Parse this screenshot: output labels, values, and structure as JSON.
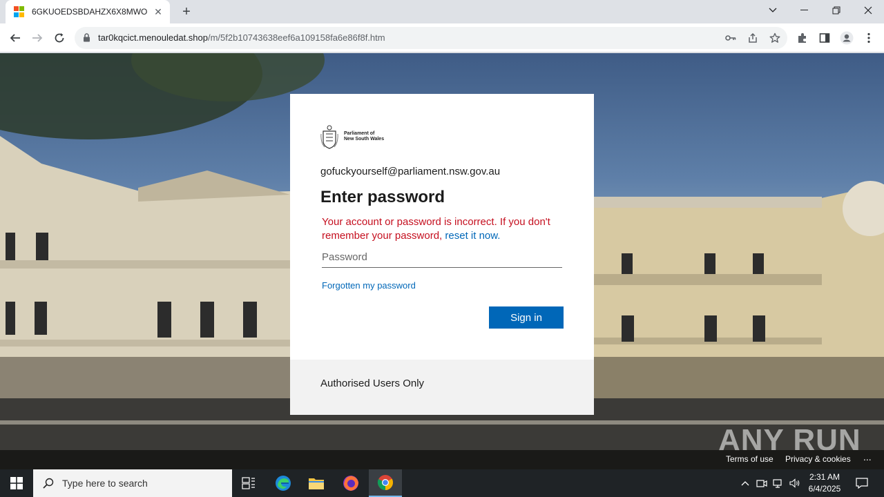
{
  "browser": {
    "tab_title": "6GKUOEDSBDAHZX6X8MWO",
    "url_host": "tar0kqcict.menouledat.shop",
    "url_path": "/m/5f2b10743638eef6a109158fa6e86f8f.htm"
  },
  "login": {
    "logo_line1": "Parliament of",
    "logo_line2": "New South Wales",
    "email": "gofuckyourself@parliament.nsw.gov.au",
    "heading": "Enter password",
    "error_text": "Your account or password is incorrect. If you don't remember your password, ",
    "error_link": "reset it now.",
    "password_placeholder": "Password",
    "forgot_link": "Forgotten my password",
    "signin_label": "Sign in",
    "footer_text": "Authorised Users Only"
  },
  "page_footer": {
    "terms": "Terms of use",
    "privacy": "Privacy & cookies",
    "more": "...",
    "watermark": "ANY RUN"
  },
  "taskbar": {
    "search_placeholder": "Type here to search",
    "time": "2:31 AM",
    "date": "6/4/2025"
  }
}
